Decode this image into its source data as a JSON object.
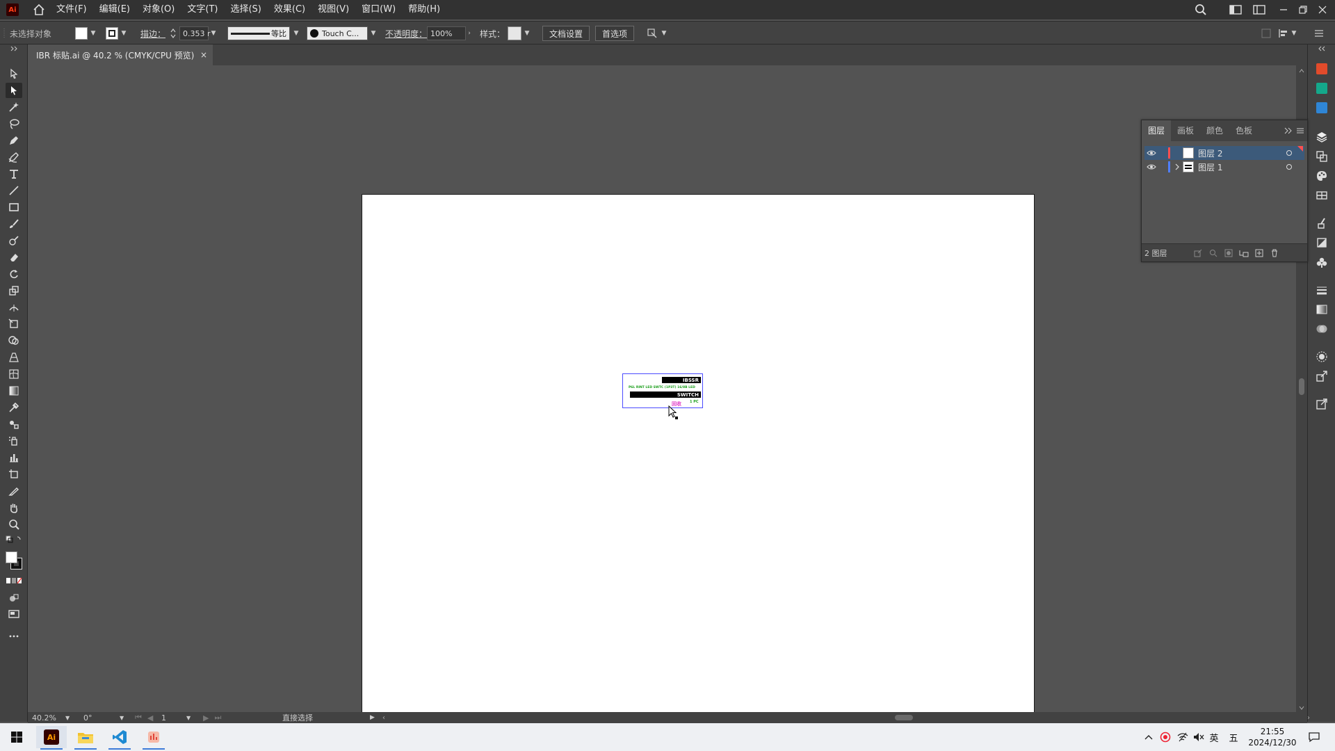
{
  "app": {
    "logo_text": "Ai",
    "menus": [
      "文件(F)",
      "编辑(E)",
      "对象(O)",
      "文字(T)",
      "选择(S)",
      "效果(C)",
      "视图(V)",
      "窗口(W)",
      "帮助(H)"
    ]
  },
  "control_bar": {
    "selection_status": "未选择对象",
    "stroke_label": "描边：",
    "stroke_value": "0.353 r",
    "profile_label": "等比",
    "brush_name": "Touch C...",
    "opacity_label": "不透明度：",
    "opacity_value": "100%",
    "style_label": "样式：",
    "doc_setup_label": "文档设置",
    "preferences_label": "首选项"
  },
  "document": {
    "tab_title": "IBR 标贴.ai @ 40.2 % (CMYK/CPU 预览)",
    "close_glyph": "×"
  },
  "artwork": {
    "brand": "IBSSR",
    "spec_line": "P6L RINT LED SWTC (1P3T) 16/8B LED",
    "product": "SWITCH",
    "qty": "1 PC",
    "mark": "回收"
  },
  "layers_panel": {
    "tabs": [
      "图层",
      "画板",
      "颜色",
      "色板"
    ],
    "active_tab": "图层",
    "layers": [
      {
        "name": "图层 2",
        "color": "#ff4f4f",
        "selected": true,
        "expandable": false
      },
      {
        "name": "图层 1",
        "color": "#4f7fff",
        "selected": false,
        "expandable": true
      }
    ],
    "count_label": "2 图层"
  },
  "status_bar": {
    "zoom": "40.2%",
    "rotation": "0°",
    "artboard_number": "1",
    "current_tool": "直接选择"
  },
  "taskbar": {
    "ime_lang": "英",
    "ime_mode": "五",
    "time": "21:55",
    "date": "2024/12/30"
  },
  "colors": {
    "accent": "#3c5a7a",
    "ai_brand": "#ff3d16",
    "selection_box": "#4b4bff",
    "label_green": "#1b9e1b",
    "label_pink": "#e03cc7"
  }
}
